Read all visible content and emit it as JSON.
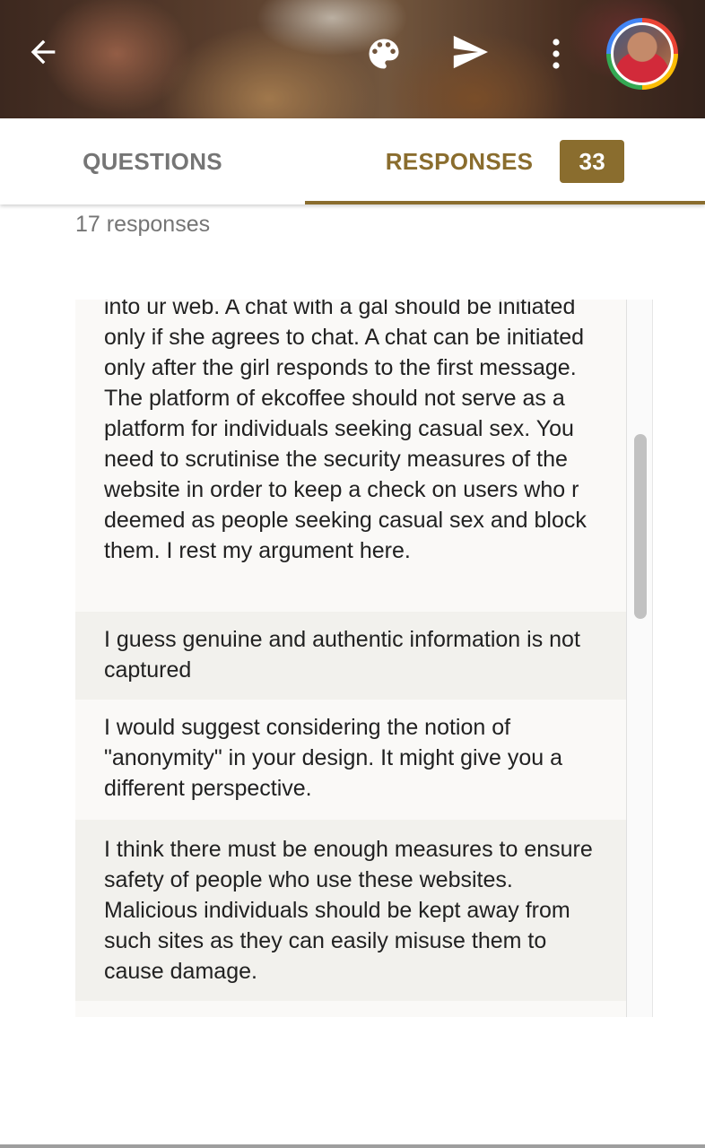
{
  "header": {
    "back_icon": "arrow-left-icon",
    "palette_icon": "palette-icon",
    "send_icon": "send-icon",
    "more_icon": "more-vert-icon",
    "avatar_icon": "user-avatar"
  },
  "tabs": {
    "questions_label": "QUESTIONS",
    "responses_label": "RESPONSES",
    "responses_count": "33"
  },
  "colors": {
    "accent": "#8a6d2e",
    "tab_inactive": "#757575"
  },
  "summary": {
    "count_text": "17 responses"
  },
  "responses": [
    "into ur web. A chat with a gal should be initiated only if she agrees to chat. A chat can be initiated only after the girl responds to the first message. The platform of ekcoffee should not serve as a platform for individuals seeking casual sex. You need to scrutinise the security measures of the website in order to keep a check on users who r deemed as people seeking casual sex and block them. I rest my argument here.",
    "I guess genuine and authentic information is not captured",
    "I would suggest considering the notion of \"anonymity\" in your design. It might give you a different perspective.",
    "I think there must be enough measures to ensure safety of people who use these websites. Malicious individuals should be kept away from such sites as they can easily misuse them to cause damage."
  ]
}
